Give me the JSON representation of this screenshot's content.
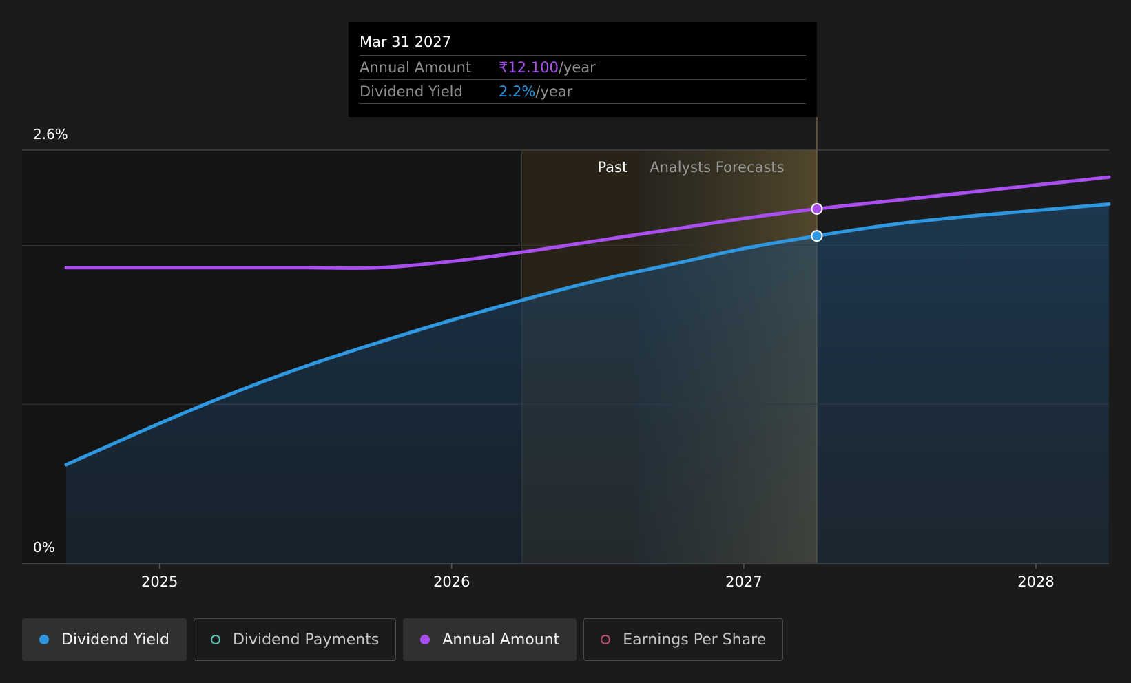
{
  "chart_data": {
    "type": "area",
    "y_axis": {
      "top_label": "2.6%",
      "bottom_label": "0%",
      "ylim": [
        0,
        2.6
      ]
    },
    "x_axis": {
      "ticks": [
        "2025",
        "2026",
        "2027",
        "2028"
      ],
      "xlim": [
        2024.68,
        2028.25
      ]
    },
    "regions": {
      "past_label": "Past",
      "forecast_label": "Analysts Forecasts",
      "past_start": 2026.24,
      "forecast_start": 2026.64,
      "cursor": 2027.25
    },
    "series": [
      {
        "name": "Dividend Yield",
        "color": "#2f97e0",
        "x": [
          2024.68,
          2025.0,
          2025.25,
          2025.5,
          2025.75,
          2026.0,
          2026.25,
          2026.5,
          2026.75,
          2027.0,
          2027.25,
          2027.5,
          2027.75,
          2028.0,
          2028.25
        ],
        "values": [
          0.62,
          0.88,
          1.07,
          1.24,
          1.39,
          1.53,
          1.66,
          1.78,
          1.88,
          1.98,
          2.06,
          2.13,
          2.18,
          2.22,
          2.26
        ]
      },
      {
        "name": "Annual Amount",
        "color": "#a94ff0",
        "x": [
          2024.68,
          2025.0,
          2025.25,
          2025.5,
          2025.75,
          2026.0,
          2026.25,
          2026.5,
          2026.75,
          2027.0,
          2027.25,
          2027.5,
          2027.75,
          2028.0,
          2028.25
        ],
        "values": [
          1.86,
          1.86,
          1.86,
          1.86,
          1.86,
          1.9,
          1.96,
          2.03,
          2.1,
          2.17,
          2.23,
          2.28,
          2.33,
          2.38,
          2.43
        ]
      }
    ]
  },
  "tooltip": {
    "date": "Mar 31 2027",
    "annual_amount_label": "Annual Amount",
    "annual_amount_value": "₹12.100",
    "annual_amount_unit": "/year",
    "dividend_yield_label": "Dividend Yield",
    "dividend_yield_value": "2.2%",
    "dividend_yield_unit": "/year"
  },
  "legend": [
    {
      "label": "Dividend Yield",
      "color": "#2f97e0",
      "active": true,
      "filled": true
    },
    {
      "label": "Dividend Payments",
      "color": "#5fc4b8",
      "active": false,
      "filled": false
    },
    {
      "label": "Annual Amount",
      "color": "#a94ff0",
      "active": true,
      "filled": true
    },
    {
      "label": "Earnings Per Share",
      "color": "#c0507a",
      "active": false,
      "filled": false
    }
  ]
}
